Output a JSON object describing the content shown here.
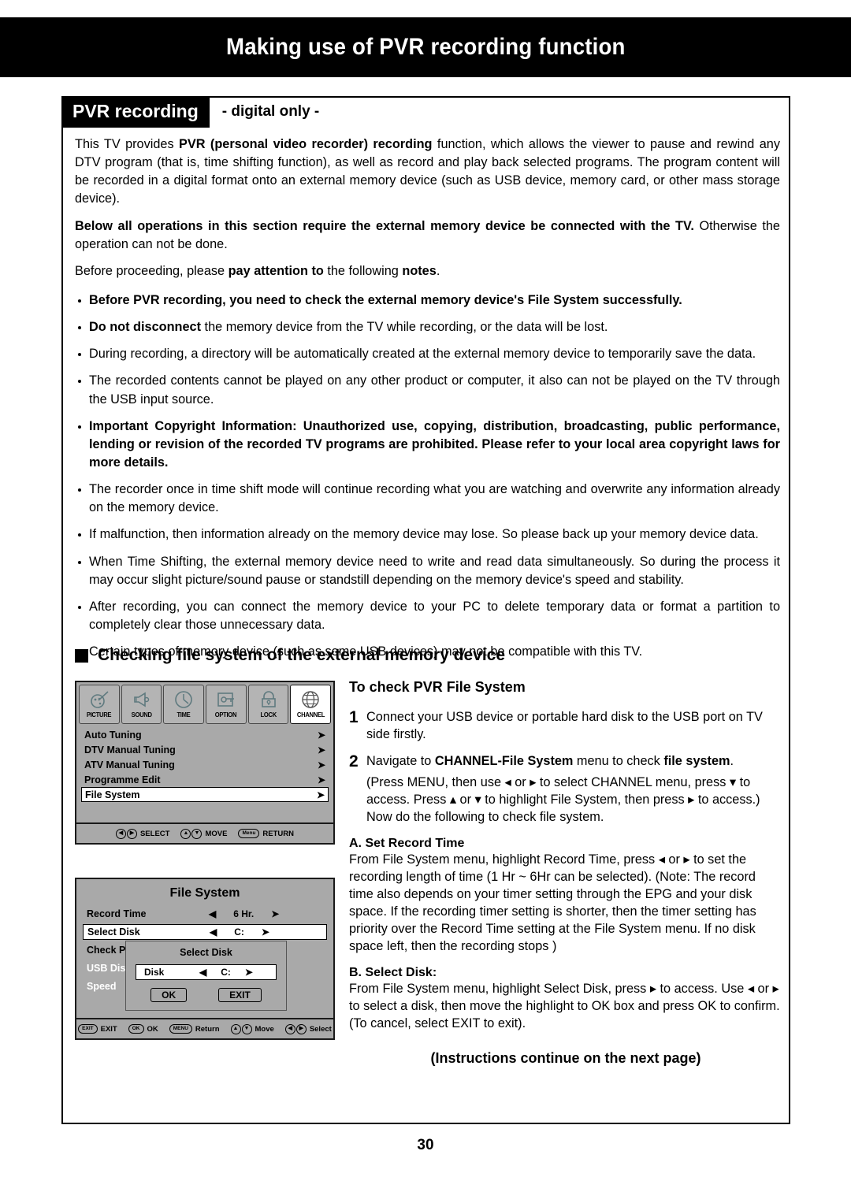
{
  "header": {
    "title": "Making use of PVR recording function"
  },
  "section": {
    "tab_label": "PVR recording",
    "tab_subtitle": "- digital only -"
  },
  "intro": {
    "p1_a": "This TV provides ",
    "p1_b": "PVR (personal video recorder) recording",
    "p1_c": " function, which allows the viewer to pause and rewind any DTV program (that is, time shifting function), as well as record and play back selected programs. The program content will be recorded in a digital format onto an external memory device (such as USB device, memory card, or other mass storage device).",
    "p2_bold": "Below all operations in this section require the external memory device be connected with the TV.",
    "p2_rest": " Otherwise the operation can not be done.",
    "p3_a": "Before proceeding, please ",
    "p3_b": "pay attention to",
    "p3_c": " the following ",
    "p3_d": "notes",
    "p3_e": "."
  },
  "notes": [
    {
      "bold": true,
      "text": "Before PVR recording, you need to check the external memory device's File System successfully."
    },
    {
      "bold": false,
      "lead": "Do not disconnect",
      "text": " the memory device from the TV while recording, or the data will be lost."
    },
    {
      "bold": false,
      "text": "During recording, a directory will be automatically created at the external memory device to temporarily save the data."
    },
    {
      "bold": false,
      "text": "The recorded contents cannot be played on any other product or computer, it also can not be played on the TV through the USB input source."
    },
    {
      "bold": true,
      "text": "Important Copyright Information: Unauthorized use, copying, distribution, broadcasting, public performance, lending or revision of the recorded TV programs are prohibited. Please refer to your local area copyright laws for more details."
    },
    {
      "bold": false,
      "text": "The recorder once in time shift mode will continue recording what you are watching and overwrite any information already on the memory device."
    },
    {
      "bold": false,
      "text": "If malfunction, then information already on the memory device may lose. So please back up your memory device data."
    },
    {
      "bold": false,
      "text": "When Time Shifting, the external memory device need to write and read data simultaneously. So during the process it may occur slight picture/sound pause or standstill depending on the memory device's speed and stability."
    },
    {
      "bold": false,
      "text": "After recording, you can connect the memory device to your PC to delete temporary data or format a partition to completely clear those unnecessary data."
    },
    {
      "bold": false,
      "text": "Certain types of memory device (such as some USB devices) may not be compatible with this TV."
    }
  ],
  "subsection": {
    "heading": "Checking file system of the external memory device"
  },
  "osd_channel": {
    "icons": [
      {
        "label": "PICTURE",
        "icon": "picture-icon",
        "active": false
      },
      {
        "label": "SOUND",
        "icon": "speaker-icon",
        "active": false
      },
      {
        "label": "TIME",
        "icon": "clock-icon",
        "active": false
      },
      {
        "label": "OPTION",
        "icon": "option-icon",
        "active": false
      },
      {
        "label": "LOCK",
        "icon": "lock-icon",
        "active": false
      },
      {
        "label": "CHANNEL",
        "icon": "globe-icon",
        "active": true
      }
    ],
    "menu_items": [
      {
        "label": "Auto Tuning",
        "arrow": "➤",
        "selected": false
      },
      {
        "label": "DTV Manual Tuning",
        "arrow": "➤",
        "selected": false
      },
      {
        "label": "ATV Manual Tuning",
        "arrow": "➤",
        "selected": false
      },
      {
        "label": "Programme Edit",
        "arrow": "➤",
        "selected": false
      },
      {
        "label": "File System",
        "arrow": "➤",
        "selected": true
      }
    ],
    "footer": [
      {
        "key_type": "circles",
        "key_left": "◀",
        "key_right": "▶",
        "label": "SELECT"
      },
      {
        "key_type": "circles",
        "key_left": "▲",
        "key_right": "▼",
        "label": "MOVE"
      },
      {
        "key_type": "oval",
        "key_text": "Menu",
        "label": "RETURN"
      }
    ]
  },
  "osd_filesystem": {
    "title": "File System",
    "rows": [
      {
        "label": "Record Time",
        "left": "◀",
        "value": "6 Hr.",
        "right": "➤",
        "selected": false,
        "dim": false
      },
      {
        "label": "Select Disk",
        "left": "◀",
        "value": "C:",
        "right": "➤",
        "selected": true,
        "dim": false
      },
      {
        "label": "Check P",
        "left": "",
        "value": "",
        "right": "",
        "selected": false,
        "dim": false
      },
      {
        "label": "USB Dis",
        "left": "",
        "value": "",
        "right": "",
        "selected": false,
        "dim": true
      },
      {
        "label": "Speed",
        "left": "",
        "value": "",
        "right": "",
        "selected": false,
        "dim": true
      }
    ],
    "dialog": {
      "title": "Select Disk",
      "field_label": "Disk",
      "field_left": "◀",
      "field_value": "C:",
      "field_right": "➤",
      "ok_label": "OK",
      "exit_label": "EXIT"
    },
    "footer": [
      {
        "key_type": "oval",
        "key_text": "EXIT",
        "label": "EXIT"
      },
      {
        "key_type": "oval",
        "key_text": "OK",
        "label": "OK"
      },
      {
        "key_type": "oval",
        "key_text": "MENU",
        "label": "Return"
      },
      {
        "key_type": "circles",
        "key_left": "▲",
        "key_right": "▼",
        "label": "Move"
      },
      {
        "key_type": "circles",
        "key_left": "◀",
        "key_right": "▶",
        "label": "Select"
      }
    ]
  },
  "instructions": {
    "heading": "To check PVR File System",
    "step1_num": "1",
    "step1_text": "Connect your USB device or portable hard disk to the USB port on TV side firstly.",
    "step2_num": "2",
    "step2_a": "Navigate to ",
    "step2_b": "CHANNEL-File System",
    "step2_c": " menu to check ",
    "step2_d": "file system",
    "step2_e": ".",
    "step2_paren": "(Press MENU, then use ◂ or ▸ to select CHANNEL menu, press ▾ to access. Press ▴ or ▾ to highlight File System, then press ▸ to access.) Now do the following to check file system.",
    "sectionA_title": "A. Set Record Time",
    "sectionA_body": "From File System menu, highlight Record Time, press ◂ or ▸ to set the recording length of time (1 Hr ~ 6Hr can be selected). (Note: The record time also depends on your timer setting through the EPG and your disk space. If the recording timer setting is shorter, then the timer setting has priority over the Record Time setting at the File System menu. If no disk space left, then the recording stops )",
    "sectionB_title": "B. Select Disk:",
    "sectionB_body": "From File System menu, highlight Select Disk, press ▸ to access. Use ◂ or ▸ to select a disk, then move the highlight to OK box and press OK to confirm. (To cancel, select EXIT to exit).",
    "continue_note": "(Instructions continue on the next page)"
  },
  "footer": {
    "page_number": "30"
  },
  "colors": {
    "banner_bg": "#000000",
    "banner_text": "#ffffff",
    "osd_bg": "#a9a9a9",
    "osd_icon_bg": "#b4b4b4",
    "osd_selected_bg": "#ffffff",
    "page_bg": "#ffffff"
  }
}
